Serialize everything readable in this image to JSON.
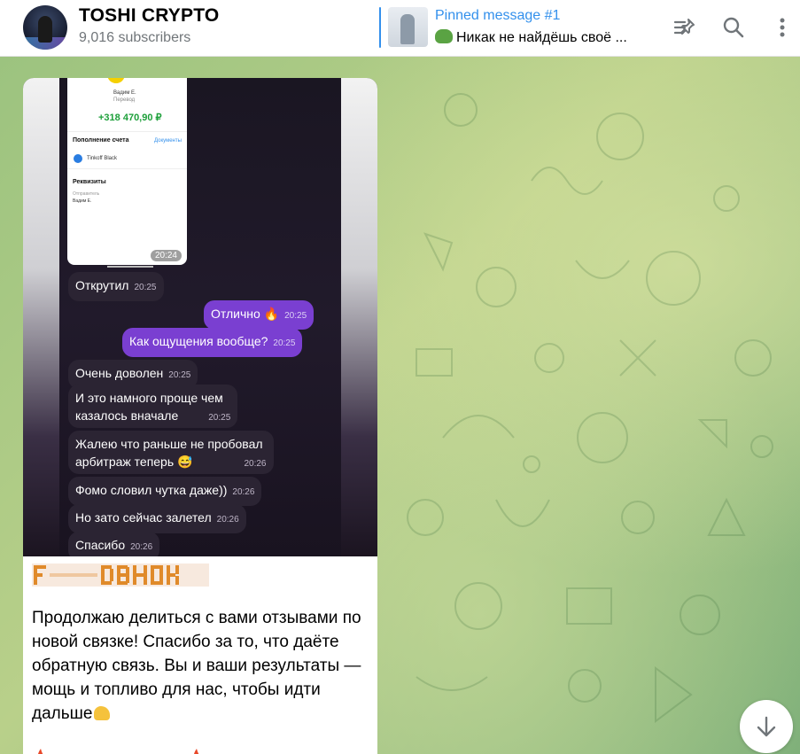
{
  "header": {
    "channel_title": "TOSHI CRYPTO",
    "subscribers": "9,016 subscribers",
    "pinned_label": "Pinned message #1",
    "pinned_text": "Никак не найдёшь своё ..."
  },
  "message": {
    "screenshot": {
      "card_name": "Вадим Е.",
      "card_sub": "Перевод",
      "amount": "+318 470,90 ₽",
      "section_topup": "Пополнение счета",
      "link_docs": "Документы",
      "bank_name": "Tinkoff Black",
      "section_req": "Реквизиты",
      "req_sub": "Отправитель",
      "req_name": "Вадим Е.",
      "card_time": "20:24",
      "chat": [
        {
          "dir": "in",
          "text": "Открутил",
          "time": "20:25"
        },
        {
          "dir": "out",
          "text": "Отлично 🔥",
          "time": "20:25"
        },
        {
          "dir": "out",
          "text": "Как ощущения вообще?",
          "time": "20:25"
        },
        {
          "dir": "in",
          "text": "Очень доволен",
          "time": "20:25"
        },
        {
          "dir": "in",
          "text": "И это намного проще чем",
          "text2": "казалось вначале",
          "time": "20:25"
        },
        {
          "dir": "in",
          "text": "Жалею что раньше не пробовал",
          "text2": "арбитраж теперь 😅",
          "time": "20:26"
        },
        {
          "dir": "in",
          "text": "Фомо словил чутка даже))",
          "time": "20:26"
        },
        {
          "dir": "in",
          "text": "Но зато сейчас залетел",
          "time": "20:26"
        },
        {
          "dir": "in",
          "text": "Спасибо",
          "time": "20:26"
        }
      ]
    },
    "caption": "Продолжаю делиться с вами отзывами по новой связке! Спасибо за то, что даёте обратную связь. Вы и ваши результаты — мощь и топливо для нас, чтобы идти дальше"
  },
  "icons": {
    "pin": "pin-list-icon",
    "search": "search-icon",
    "more": "more-vertical-icon",
    "scroll": "arrow-down-icon"
  },
  "colors": {
    "accent": "#3390ec",
    "outgoing_bubble": "#7a3fd1",
    "incoming_bubble": "#2b2433",
    "amount_green": "#1da03a"
  }
}
